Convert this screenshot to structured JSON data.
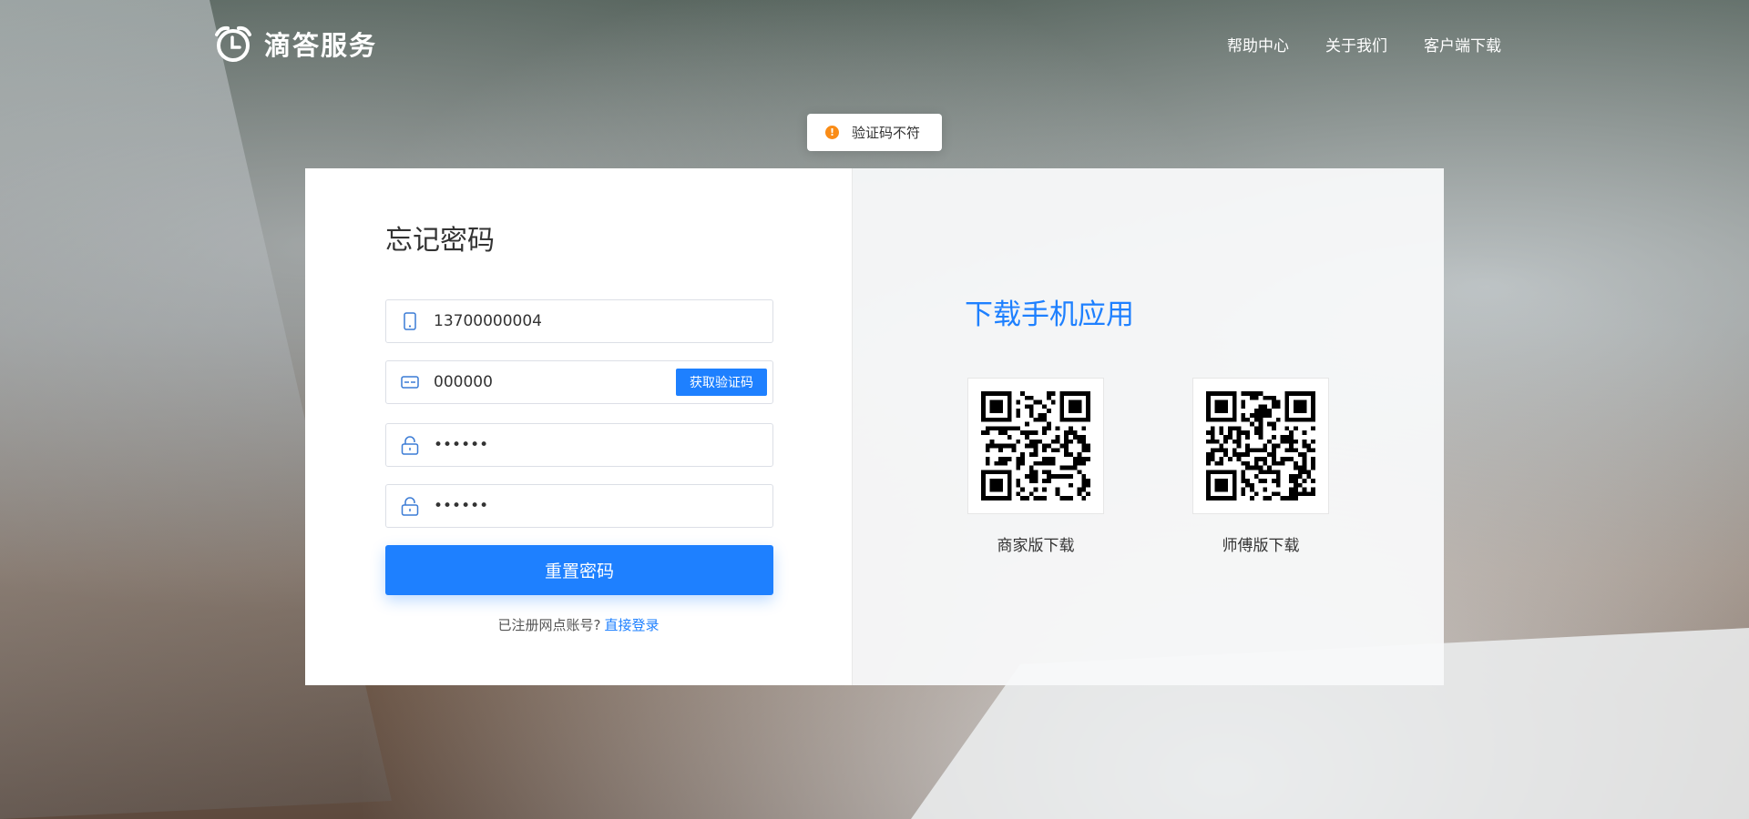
{
  "header": {
    "brand_name": "滴答服务",
    "nav": [
      {
        "label": "帮助中心"
      },
      {
        "label": "关于我们"
      },
      {
        "label": "客户端下载"
      }
    ]
  },
  "toast": {
    "message": "验证码不符",
    "icon": "warning-icon",
    "color": "#fa8c16"
  },
  "form": {
    "title": "忘记密码",
    "phone_value": "13700000004",
    "code_value": "000000",
    "get_code_label": "获取验证码",
    "password_value": "000000",
    "confirm_password_value": "000000",
    "submit_label": "重置密码",
    "hint_text": "已注册网点账号?",
    "login_link": "直接登录"
  },
  "download": {
    "title": "下载手机应用",
    "apps": [
      {
        "label": "商家版下载"
      },
      {
        "label": "师傅版下载"
      }
    ]
  },
  "colors": {
    "accent": "#1e80ff",
    "warning": "#fa8c16"
  }
}
